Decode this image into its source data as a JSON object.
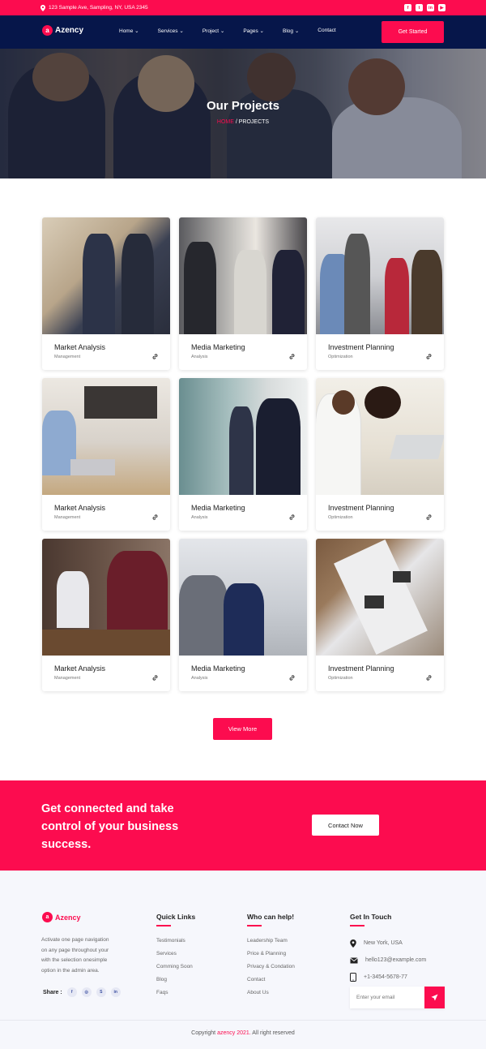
{
  "topbar": {
    "address": "123 Sample Ave, Sampling, NY, USA 2345",
    "social_icons": [
      "facebook-icon",
      "twitter-icon",
      "linkedin-icon",
      "youtube-icon"
    ]
  },
  "header": {
    "brand": "Azency",
    "logo_mark": "a",
    "menu": [
      "Home",
      "Services",
      "Project",
      "Pages",
      "Blog",
      "Contact"
    ],
    "menu_dropdown": [
      true,
      true,
      true,
      true,
      true,
      false
    ],
    "cta": "Get Started"
  },
  "hero": {
    "title": "Our Projects",
    "breadcrumb_home": "HOME",
    "breadcrumb_sep": "/",
    "breadcrumb_current": "PROJECTS"
  },
  "projects": [
    {
      "title": "Market Analysis",
      "category": "Management"
    },
    {
      "title": "Media Marketing",
      "category": "Analysis"
    },
    {
      "title": "Investment Planning",
      "category": "Optimization"
    },
    {
      "title": "Market Analysis",
      "category": "Management"
    },
    {
      "title": "Media Marketing",
      "category": "Analysis"
    },
    {
      "title": "Investment Planning",
      "category": "Optimization"
    },
    {
      "title": "Market Analysis",
      "category": "Management"
    },
    {
      "title": "Media Marketing",
      "category": "Analysis"
    },
    {
      "title": "Investment Planning",
      "category": "Optimization"
    }
  ],
  "view_more": "View More",
  "cta_banner": {
    "line1": "Get connected and take",
    "line2": "control of your business",
    "line3": "success.",
    "button": "Contact Now"
  },
  "footer": {
    "brand": "Azency",
    "desc_lines": [
      "Activate one page navigation",
      "on any page throughout your",
      "with the selection onesimple",
      "option in the admin area."
    ],
    "share_label": "Share :",
    "share_icons": [
      "f",
      "◎",
      "S",
      "in"
    ],
    "quick_links_title": "Quick Links",
    "quick_links": [
      "Testimonials",
      "Services",
      "Comming Soon",
      "Blog",
      "Faqs"
    ],
    "help_title": "Who can help!",
    "help_links": [
      "Leadership Team",
      "Price & Planning",
      "Privacy & Condation",
      "Contact",
      "About Us"
    ],
    "touch_title": "Get In Touch",
    "location": "New York, USA",
    "email": "hello123@example.com",
    "phone": "+1-3454-5678-77",
    "email_placeholder": "Enter your email",
    "copyright_prefix": "Copyright",
    "copyright_brand": "azency 2021.",
    "copyright_suffix": "All right reserved"
  },
  "colors": {
    "accent": "#fc0c4f",
    "navy": "#06164a",
    "footer_bg": "#f6f7fc"
  }
}
